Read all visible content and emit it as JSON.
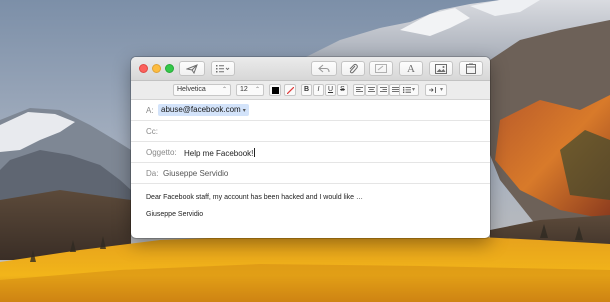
{
  "toolbar": {
    "send_icon": "paper-plane-icon",
    "header_fields_icon": "list-icon",
    "reply_icon": "reply-arrow-icon",
    "attach_icon": "paperclip-icon",
    "markup_icon": "markup-icon",
    "fonts_label": "A",
    "photo_icon": "photo-browser-icon",
    "stationery_icon": "stationery-icon"
  },
  "format": {
    "font_family": "Helvetica",
    "font_size": "12",
    "text_color": "#000000",
    "bold": "B",
    "italic": "I",
    "underline": "U",
    "strike": "S"
  },
  "email": {
    "to_label": "A:",
    "to_value": "abuse@facebook.com",
    "cc_label": "Cc:",
    "subject_label": "Oggetto:",
    "subject_value": "Help me Facebook!",
    "from_label": "Da:",
    "from_value": "Giuseppe Servidio",
    "body_line": "Dear Facebook staff, my account has been hacked and I would like …",
    "signature": "Giuseppe Servidio"
  },
  "colors": {
    "token_bg": "#d3e3fa",
    "close": "#fc605c",
    "minimize": "#fdbc40",
    "zoom": "#34c84a"
  }
}
